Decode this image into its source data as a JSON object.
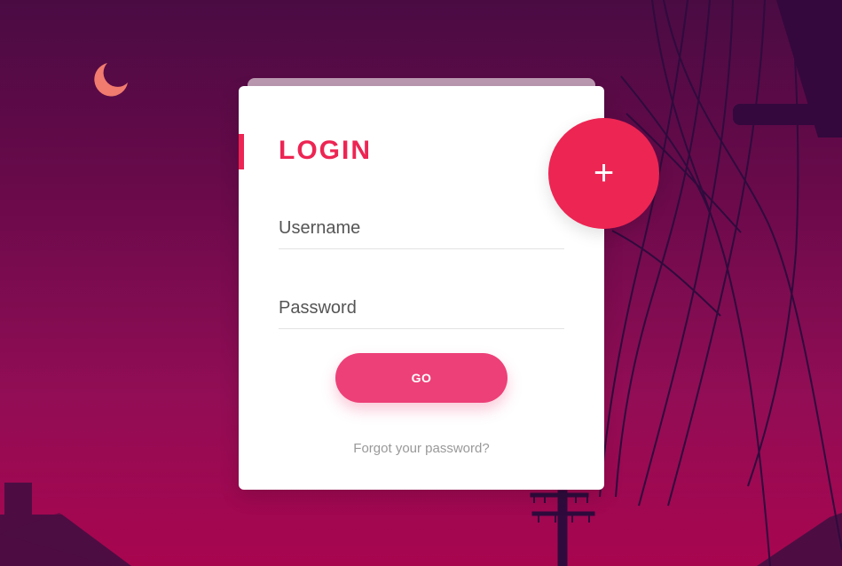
{
  "login": {
    "title": "LOGIN",
    "username_placeholder": "Username",
    "password_placeholder": "Password",
    "go_label": "GO",
    "forgot_password": "Forgot your password?",
    "plus_label": "+"
  },
  "colors": {
    "accent": "#ed2553",
    "button": "#ed4078",
    "background_top": "#4a0b43",
    "background_bottom": "#a8054f",
    "card": "#ffffff"
  },
  "icons": {
    "moon": "moon-icon",
    "plus": "plus-icon"
  }
}
